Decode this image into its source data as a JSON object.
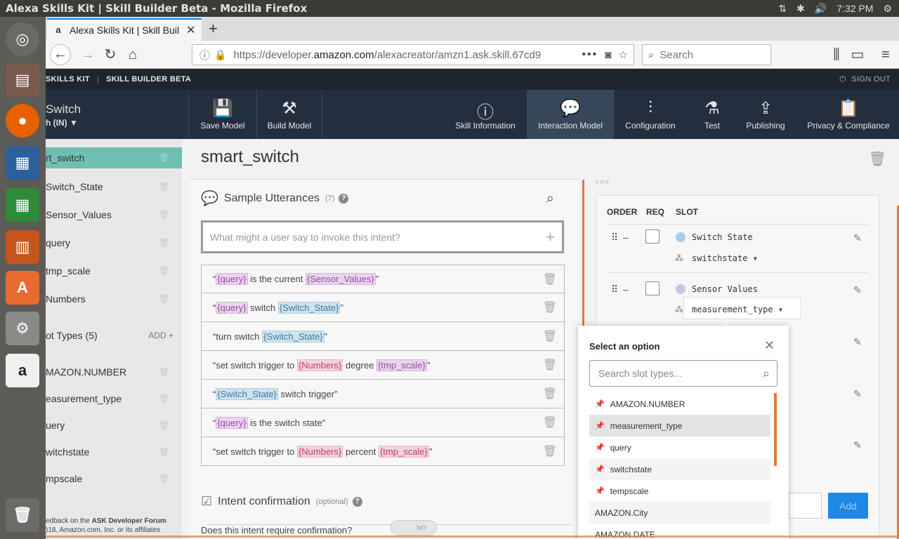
{
  "os": {
    "window_title": "Alexa Skills Kit | Skill Builder Beta - Mozilla Firefox",
    "time": "7:32 PM"
  },
  "browser": {
    "tab_title": "Alexa Skills Kit | Skill Buil",
    "url_prefix": "https://developer.",
    "url_domain": "amazon.com",
    "url_rest": "/alexacreator/amzn1.ask.skill.67cd9",
    "search_placeholder": "Search"
  },
  "ask_header": {
    "brand": "SKILLS KIT",
    "product": "SKILL BUILDER BETA",
    "sign_out": "SIGN OUT"
  },
  "toolbar": {
    "skill_name": "Switch",
    "locale": "h (IN)",
    "save_model": "Save Model",
    "build_model": "Build Model",
    "skill_information": "Skill Information",
    "interaction_model": "Interaction Model",
    "configuration": "Configuration",
    "test": "Test",
    "publishing": "Publishing",
    "privacy": "Privacy & Compliance"
  },
  "sidebar": {
    "intents": [
      {
        "label": "rt_switch"
      },
      {
        "label": "Switch_State"
      },
      {
        "label": "Sensor_Values"
      },
      {
        "label": "query"
      },
      {
        "label": "tmp_scale"
      },
      {
        "label": "Numbers"
      }
    ],
    "slot_types_heading": "ot Types (5)",
    "add_label": "ADD",
    "slot_types": [
      {
        "label": "MAZON.NUMBER"
      },
      {
        "label": "easurement_type"
      },
      {
        "label": "uery"
      },
      {
        "label": "witchstate"
      },
      {
        "label": "mpscale"
      }
    ],
    "footer_line1_prefix": "edback on the ",
    "footer_line1_link": "ASK Developer Forum",
    "footer_line2": ")18, Amazon.com, Inc. or its affiliates"
  },
  "intent": {
    "title": "smart_switch",
    "utterances_heading": "Sample Utterances",
    "utterances_count": "(7)",
    "input_placeholder": "What might a user say to invoke this intent?",
    "utterances": [
      [
        {
          "t": "“"
        },
        {
          "s": "{query}",
          "c": "purple"
        },
        {
          "t": " is the current "
        },
        {
          "s": "{Sensor_Values}",
          "c": "purple"
        },
        {
          "t": "”"
        }
      ],
      [
        {
          "t": "“"
        },
        {
          "s": "{query}",
          "c": "purple"
        },
        {
          "t": " switch "
        },
        {
          "s": "{Switch_State}",
          "c": "blue"
        },
        {
          "t": "”"
        }
      ],
      [
        {
          "t": "“turn switch "
        },
        {
          "s": "{Switch_State}",
          "c": "blue"
        },
        {
          "t": "”"
        }
      ],
      [
        {
          "t": "“set switch trigger to "
        },
        {
          "s": "{Numbers}",
          "c": "pink"
        },
        {
          "t": " degree "
        },
        {
          "s": "{tmp_scale}",
          "c": "purple"
        },
        {
          "t": "”"
        }
      ],
      [
        {
          "t": "“"
        },
        {
          "s": "{Switch_State}",
          "c": "blue"
        },
        {
          "t": " switch trigger”"
        }
      ],
      [
        {
          "t": "“"
        },
        {
          "s": "{query}",
          "c": "purple"
        },
        {
          "t": " is the switch state”"
        }
      ],
      [
        {
          "t": "“set switch trigger to "
        },
        {
          "s": "{Numbers}",
          "c": "pink"
        },
        {
          "t": " percent "
        },
        {
          "s": "{tmp_scale}",
          "c": "pink"
        },
        {
          "t": "”"
        }
      ]
    ],
    "confirmation_heading": "Intent confirmation",
    "confirmation_optional": "(optional)",
    "confirmation_question": "Does this intent require confirmation?",
    "toggle_label": "NO"
  },
  "slots": {
    "col_order": "ORDER",
    "col_req": "REQ",
    "col_slot": "SLOT",
    "rows": [
      {
        "name": "Switch State",
        "type": "switchstate",
        "dot_color": "#a9cfe8"
      },
      {
        "name": "Sensor Values",
        "type": "measurement_type",
        "dot_color": "#c9c3ea"
      }
    ],
    "add_button": "Add"
  },
  "popover": {
    "title": "Select an option",
    "search_placeholder": "Search slot types...",
    "custom_options": [
      "AMAZON.NUMBER",
      "measurement_type",
      "query",
      "switchstate",
      "tempscale"
    ],
    "builtin_options": [
      "AMAZON.City",
      "AMAZON.DATE"
    ],
    "selected": "measurement_type"
  }
}
